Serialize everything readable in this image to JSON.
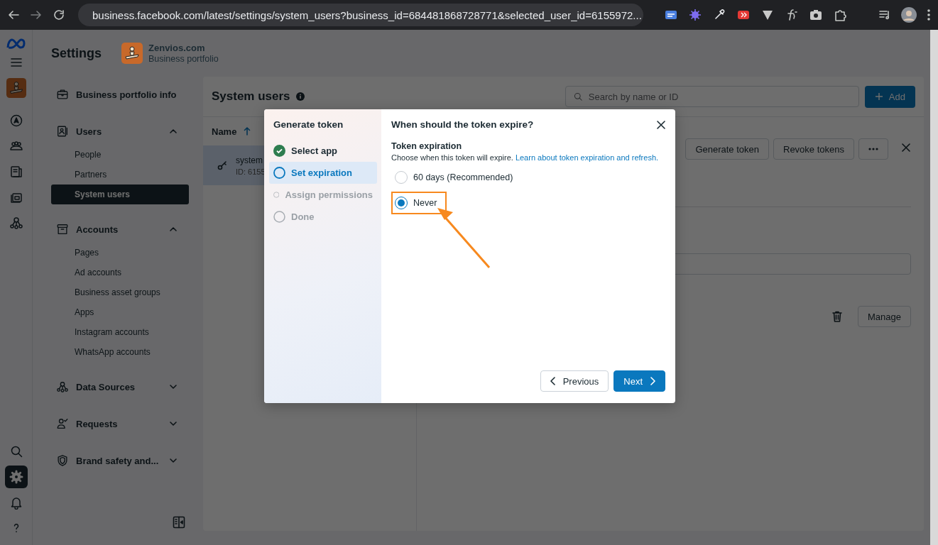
{
  "browser": {
    "url": "business.facebook.com/latest/settings/system_users?business_id=684481868728771&selected_user_id=6155972..."
  },
  "header": {
    "title": "Settings",
    "portfolio_name": "Zenvios.com",
    "portfolio_type": "Business portfolio"
  },
  "rail": {
    "top": [
      {
        "kind": "compass",
        "selected": false
      },
      {
        "kind": "people",
        "selected": false
      },
      {
        "kind": "pages",
        "selected": false
      },
      {
        "kind": "ads",
        "selected": false
      },
      {
        "kind": "network",
        "selected": false
      }
    ],
    "bottom": [
      {
        "kind": "search",
        "selected": false
      },
      {
        "kind": "settings",
        "selected": true
      },
      {
        "kind": "bell",
        "selected": false
      },
      {
        "kind": "help",
        "selected": false
      }
    ]
  },
  "sidebar": {
    "sections": [
      {
        "label": "Business portfolio info",
        "kind": "link"
      },
      {
        "label": "Users",
        "kind": "group",
        "expanded": true,
        "children": [
          {
            "label": "People",
            "selected": false
          },
          {
            "label": "Partners",
            "selected": false
          },
          {
            "label": "System users",
            "selected": true
          }
        ]
      },
      {
        "label": "Accounts",
        "kind": "group",
        "expanded": true,
        "children": [
          {
            "label": "Pages",
            "selected": false
          },
          {
            "label": "Ad accounts",
            "selected": false
          },
          {
            "label": "Business asset groups",
            "selected": false
          },
          {
            "label": "Apps",
            "selected": false
          },
          {
            "label": "Instagram accounts",
            "selected": false
          },
          {
            "label": "WhatsApp accounts",
            "selected": false
          }
        ]
      },
      {
        "label": "Data Sources",
        "kind": "group",
        "expanded": false
      },
      {
        "label": "Requests",
        "kind": "group",
        "expanded": false
      },
      {
        "label": "Brand safety and...",
        "kind": "group",
        "expanded": false
      }
    ]
  },
  "main": {
    "title": "System users",
    "search": {
      "placeholder": "Search by name or ID"
    },
    "add_button": "Add",
    "column": "Name",
    "rows": [
      {
        "name": "system",
        "id": "ID: 6155",
        "selected": true
      }
    ],
    "actions": [
      "Generate token",
      "Revoke tokens"
    ],
    "manage_button": "Manage"
  },
  "modal": {
    "steps_title": "Generate token",
    "steps": [
      {
        "label": "Select app",
        "completed": true,
        "selected": false
      },
      {
        "label": "Set expiration",
        "completed": false,
        "selected": true
      },
      {
        "label": "Assign permissions",
        "completed": false,
        "selected": false
      },
      {
        "label": "Done",
        "completed": false,
        "selected": false
      }
    ],
    "title": "When should the token expire?",
    "section_title": "Token expiration",
    "description": "Choose when this token will expire.",
    "link": "Learn about token expiration and refresh.",
    "options": [
      {
        "label": "60 days (Recommended)",
        "selected": false
      },
      {
        "label": "Never",
        "selected": true
      }
    ],
    "buttons": [
      {
        "label": "Previous",
        "kind": "secondary"
      },
      {
        "label": "Next",
        "kind": "primary"
      }
    ]
  }
}
